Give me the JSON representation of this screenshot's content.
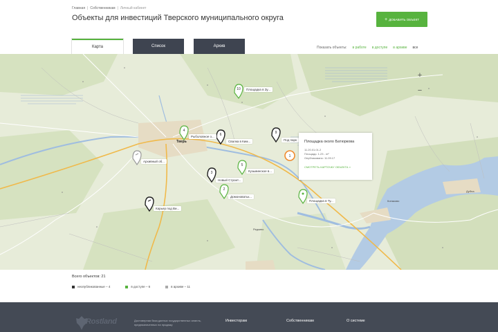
{
  "breadcrumb": {
    "home": "Главная",
    "owners": "Собственникам",
    "current": "Личный кабинет"
  },
  "page_title": "Объекты для инвестиций Тверского муниципального округа",
  "add_button": {
    "icon": "+",
    "label": "Добавить объект"
  },
  "tabs": [
    {
      "label": "Карта"
    },
    {
      "label": "Список"
    },
    {
      "label": "Архив"
    }
  ],
  "show_objects": {
    "label": "Показать объекты:",
    "options": [
      "в работе",
      "в доступе",
      "в архиве",
      "все"
    ]
  },
  "map": {
    "cities": {
      "tver": "Тверь",
      "konakovo": "Конаково",
      "dubna": "Дубна",
      "redkino": "Редкино"
    },
    "markers": [
      {
        "number": "10",
        "label": "Площадка в Зу...",
        "status": "green"
      },
      {
        "number": "4",
        "label": "Рыболовное о...",
        "status": "green"
      },
      {
        "number": "6",
        "label": "Свалка в Ким...",
        "status": "black"
      },
      {
        "number": "9",
        "label": "Под парк",
        "status": "black"
      },
      {
        "number": "1",
        "label": "",
        "status": "orange"
      },
      {
        "number": "",
        "label": "Архивный об...",
        "status": "gray"
      },
      {
        "number": "3",
        "label": "Новый Строит...",
        "status": "black"
      },
      {
        "number": "5",
        "label": "Кузьминское в...",
        "status": "green"
      },
      {
        "number": "2",
        "label": "Домоноватьк...",
        "status": "green"
      },
      {
        "number": "",
        "label": "Площадка в Ту...",
        "status": "green"
      },
      {
        "number": "",
        "label": "Карьер под Ви...",
        "status": "black"
      }
    ],
    "popup": {
      "title": "Площадка около Батюркова",
      "lines": [
        "11.20.01.01.2",
        "Площадь: 1.23 - m²",
        "Опубликовано: 11.09.17"
      ],
      "link": "Смотреть карточку объекта »"
    },
    "zoom_in": "+",
    "zoom_out": "−"
  },
  "stats": {
    "total": "Всего объектов: 21",
    "legend": [
      {
        "label": "неопубликованные – 4",
        "color": "#333333"
      },
      {
        "label": "в доступе – 6",
        "color": "#57b33e"
      },
      {
        "label": "в архиве – 11",
        "color": "#aaaaaa"
      }
    ]
  },
  "footer": {
    "logo": "Rostland",
    "description": "Достоверная база данных государственных земель, предназначенных на продажу",
    "col1": "Инвесторам",
    "col2": "Собственникам",
    "col3": "О системе"
  },
  "colors": {
    "accent": "#57b33e",
    "dark": "#3e4450",
    "footer": "#444a55"
  }
}
